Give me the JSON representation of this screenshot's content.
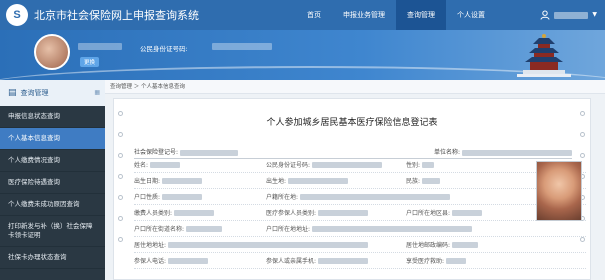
{
  "app": {
    "logo_text": "S",
    "title": "北京市社会保险网上申报查询系统"
  },
  "nav": {
    "items": [
      "首页",
      "申报业务管理",
      "查询管理",
      "个人设置"
    ],
    "active_index": 2
  },
  "banner": {
    "id_label": "公民身份证号码:",
    "tag": "更换"
  },
  "sidebar": {
    "header": "查询管理",
    "items": [
      "申报信息状态查询",
      "个人基本信息查询",
      "个人缴费情况查询",
      "医疗保险待遇查询",
      "个人缴费未成功原因查询",
      "打印新发与补（换）社会保障卡领卡证明",
      "社保卡办理状态查询"
    ],
    "active_index": 1
  },
  "breadcrumb": "查询管理 ＞ 个人基本信息查询",
  "form": {
    "title": "个人参加城乡居民基本医疗保险信息登记表",
    "meta_left": "社会保险登记号:",
    "meta_right": "单位名称:",
    "rows": [
      [
        "姓名:",
        "公民身份证号码:",
        "性别:"
      ],
      [
        "出生日期:",
        "出生地:",
        "民族:"
      ],
      [
        "户口性质:",
        "户籍所在地:",
        ""
      ],
      [
        "缴费人员类别:",
        "医疗参保人员类别:",
        "户口所在地区县:"
      ],
      [
        "户口所在街道名称:",
        "户口所在地地址:",
        ""
      ],
      [
        "居住地地址:",
        "",
        "居住地邮政编码:"
      ],
      [
        "参保人电话:",
        "参保人或亲属手机:",
        "享受医疗救助:"
      ]
    ]
  },
  "colors": {
    "topbar": "#2f6daf",
    "nav_active": "#1c5494",
    "sidebar_bg": "#2a3843",
    "sidebar_active": "#3f7cc3"
  }
}
